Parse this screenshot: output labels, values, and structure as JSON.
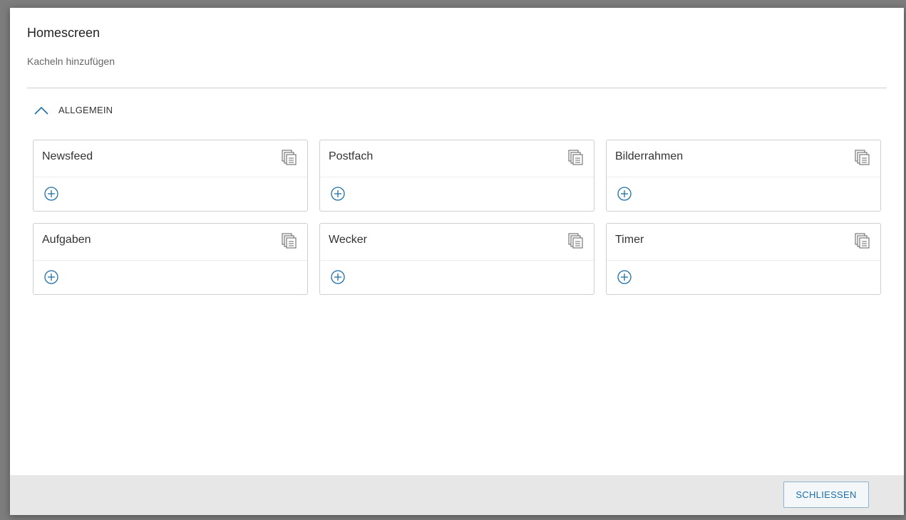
{
  "dialog": {
    "title": "Homescreen",
    "subtitle": "Kacheln hinzufügen",
    "section": {
      "label": "ALLGEMEIN",
      "expanded": true,
      "icon": "chevron-up-icon"
    },
    "tiles": [
      {
        "title": "Newsfeed",
        "copy_icon": "copy-icon",
        "add_icon": "plus-circle-icon"
      },
      {
        "title": "Postfach",
        "copy_icon": "copy-icon",
        "add_icon": "plus-circle-icon"
      },
      {
        "title": "Bilderrahmen",
        "copy_icon": "copy-icon",
        "add_icon": "plus-circle-icon"
      },
      {
        "title": "Aufgaben",
        "copy_icon": "copy-icon",
        "add_icon": "plus-circle-icon"
      },
      {
        "title": "Wecker",
        "copy_icon": "copy-icon",
        "add_icon": "plus-circle-icon"
      },
      {
        "title": "Timer",
        "copy_icon": "copy-icon",
        "add_icon": "plus-circle-icon"
      }
    ],
    "footer": {
      "close_label": "SCHLIESSEN"
    }
  },
  "colors": {
    "accent": "#1d6fa8",
    "icon_gray": "#777777",
    "footer_bg": "#e7e7e7"
  }
}
